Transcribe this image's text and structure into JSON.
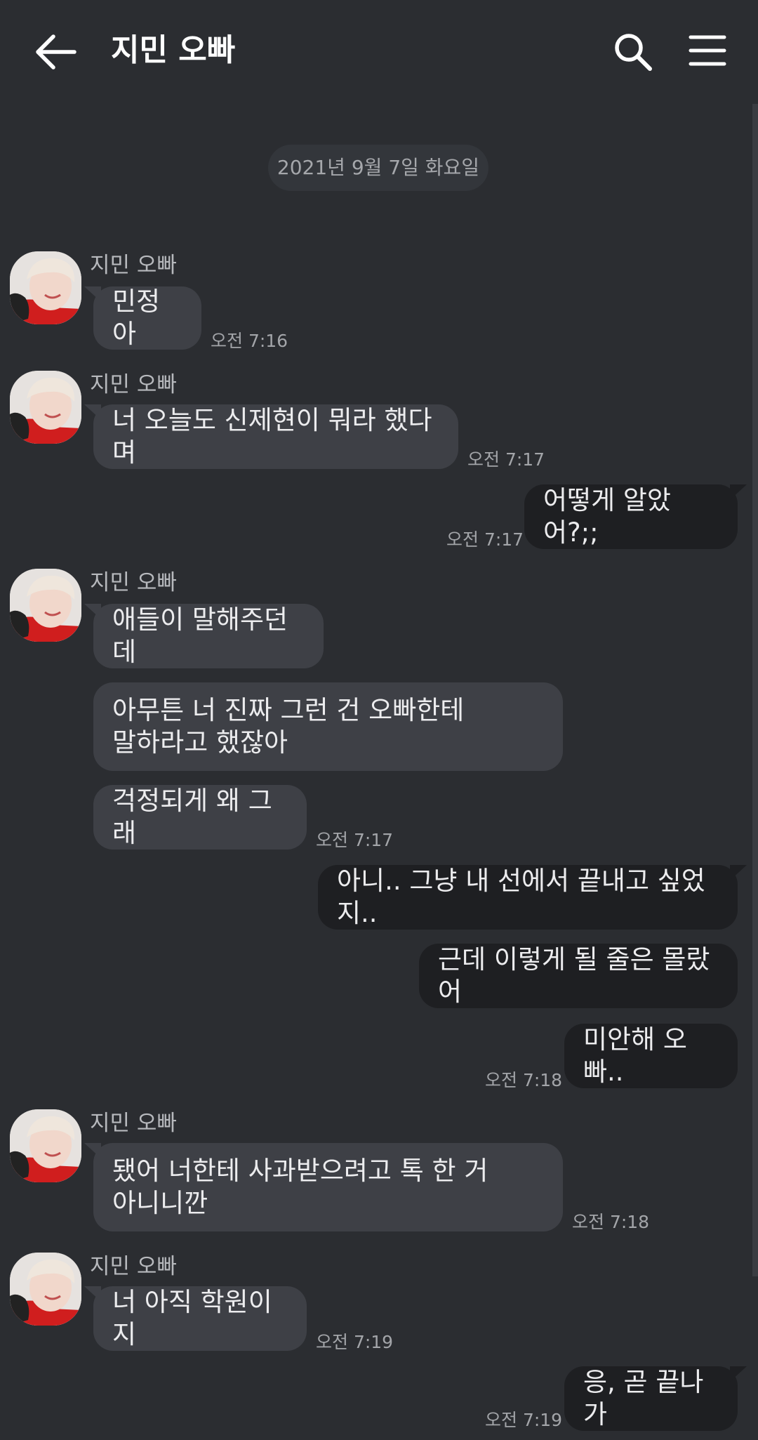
{
  "header": {
    "title": "지민 오빠"
  },
  "date_divider": "2021년 9월 7일 화요일",
  "sender_name": "지민 오빠",
  "messages": [
    {
      "text": "민정아",
      "time": "오전 7:16"
    },
    {
      "text": "너 오늘도 신제현이 뭐라 했다며",
      "time": "오전 7:17"
    },
    {
      "text": "어떻게 알았어?;;",
      "time": "오전 7:17"
    },
    {
      "text": "애들이 말해주던데"
    },
    {
      "line1": "아무튼 너 진짜 그런 건 오빠한테",
      "line2": "말하라고 했잖아"
    },
    {
      "text": "걱정되게 왜 그래",
      "time": "오전 7:17"
    },
    {
      "text": "아니.. 그냥 내 선에서 끝내고 싶었지.."
    },
    {
      "text": "근데 이렇게 될 줄은 몰랐어"
    },
    {
      "text": "미안해 오빠..",
      "time": "오전 7:18"
    },
    {
      "line1": "됐어 너한테 사과받으려고 톡 한 거",
      "line2": "아니니깐",
      "time": "오전 7:18"
    },
    {
      "text": "너 아직 학원이지",
      "time": "오전 7:19"
    },
    {
      "text": "응, 곧 끝나가",
      "time": "오전 7:19"
    }
  ],
  "colors": {
    "background": "#2b2d31",
    "incoming_bubble": "#3e4046",
    "outgoing_bubble": "#1e1f22"
  }
}
